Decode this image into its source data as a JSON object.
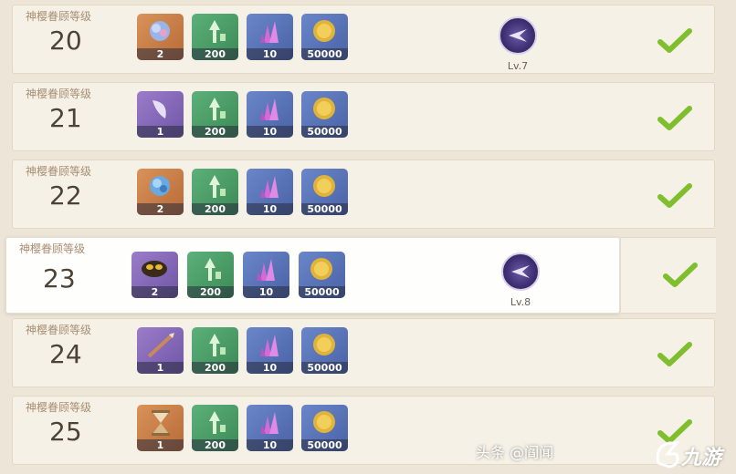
{
  "rows": [
    {
      "label": "神樱眷顾等级",
      "level": "20",
      "items": [
        {
          "icon": "orange-flower-icon",
          "count": "2"
        },
        {
          "icon": "green-exp-book-icon",
          "count": "200"
        },
        {
          "icon": "crystal-ore-icon",
          "count": "10"
        },
        {
          "icon": "mora-coin-icon",
          "count": "50000"
        }
      ],
      "skill_lv": "Lv.7",
      "claimed": true
    },
    {
      "label": "神樱眷顾等级",
      "level": "21",
      "items": [
        {
          "icon": "purple-moon-icon",
          "count": "1"
        },
        {
          "icon": "green-exp-book-icon",
          "count": "200"
        },
        {
          "icon": "crystal-ore-icon",
          "count": "10"
        },
        {
          "icon": "mora-coin-icon",
          "count": "50000"
        }
      ],
      "skill_lv": "",
      "claimed": true
    },
    {
      "label": "神樱眷顾等级",
      "level": "22",
      "items": [
        {
          "icon": "blue-flower-icon",
          "count": "2"
        },
        {
          "icon": "green-exp-book-icon",
          "count": "200"
        },
        {
          "icon": "crystal-ore-icon",
          "count": "10"
        },
        {
          "icon": "mora-coin-icon",
          "count": "50000"
        }
      ],
      "skill_lv": "",
      "claimed": true
    },
    {
      "label": "神樱眷顾等级",
      "level": "23",
      "items": [
        {
          "icon": "mask-icon",
          "count": "2"
        },
        {
          "icon": "green-exp-book-icon",
          "count": "200"
        },
        {
          "icon": "crystal-ore-icon",
          "count": "10"
        },
        {
          "icon": "mora-coin-icon",
          "count": "50000"
        }
      ],
      "skill_lv": "Lv.8",
      "claimed": true
    },
    {
      "label": "神樱眷顾等级",
      "level": "24",
      "items": [
        {
          "icon": "polearm-icon",
          "count": "1"
        },
        {
          "icon": "green-exp-book-icon",
          "count": "200"
        },
        {
          "icon": "crystal-ore-icon",
          "count": "10"
        },
        {
          "icon": "mora-coin-icon",
          "count": "50000"
        }
      ],
      "skill_lv": "",
      "claimed": true
    },
    {
      "label": "神樱眷顾等级",
      "level": "25",
      "items": [
        {
          "icon": "hourglass-icon",
          "count": "1"
        },
        {
          "icon": "green-exp-book-icon",
          "count": "200"
        },
        {
          "icon": "crystal-ore-icon",
          "count": "10"
        },
        {
          "icon": "mora-coin-icon",
          "count": "50000"
        }
      ],
      "skill_lv": "",
      "claimed": true
    }
  ],
  "watermark": "头条 @阎闻",
  "logo_text": "九游",
  "colors": {
    "check": "#7fbf2e",
    "skill_bg": "#3d2f72",
    "row_bg": "#f6f1e6"
  }
}
